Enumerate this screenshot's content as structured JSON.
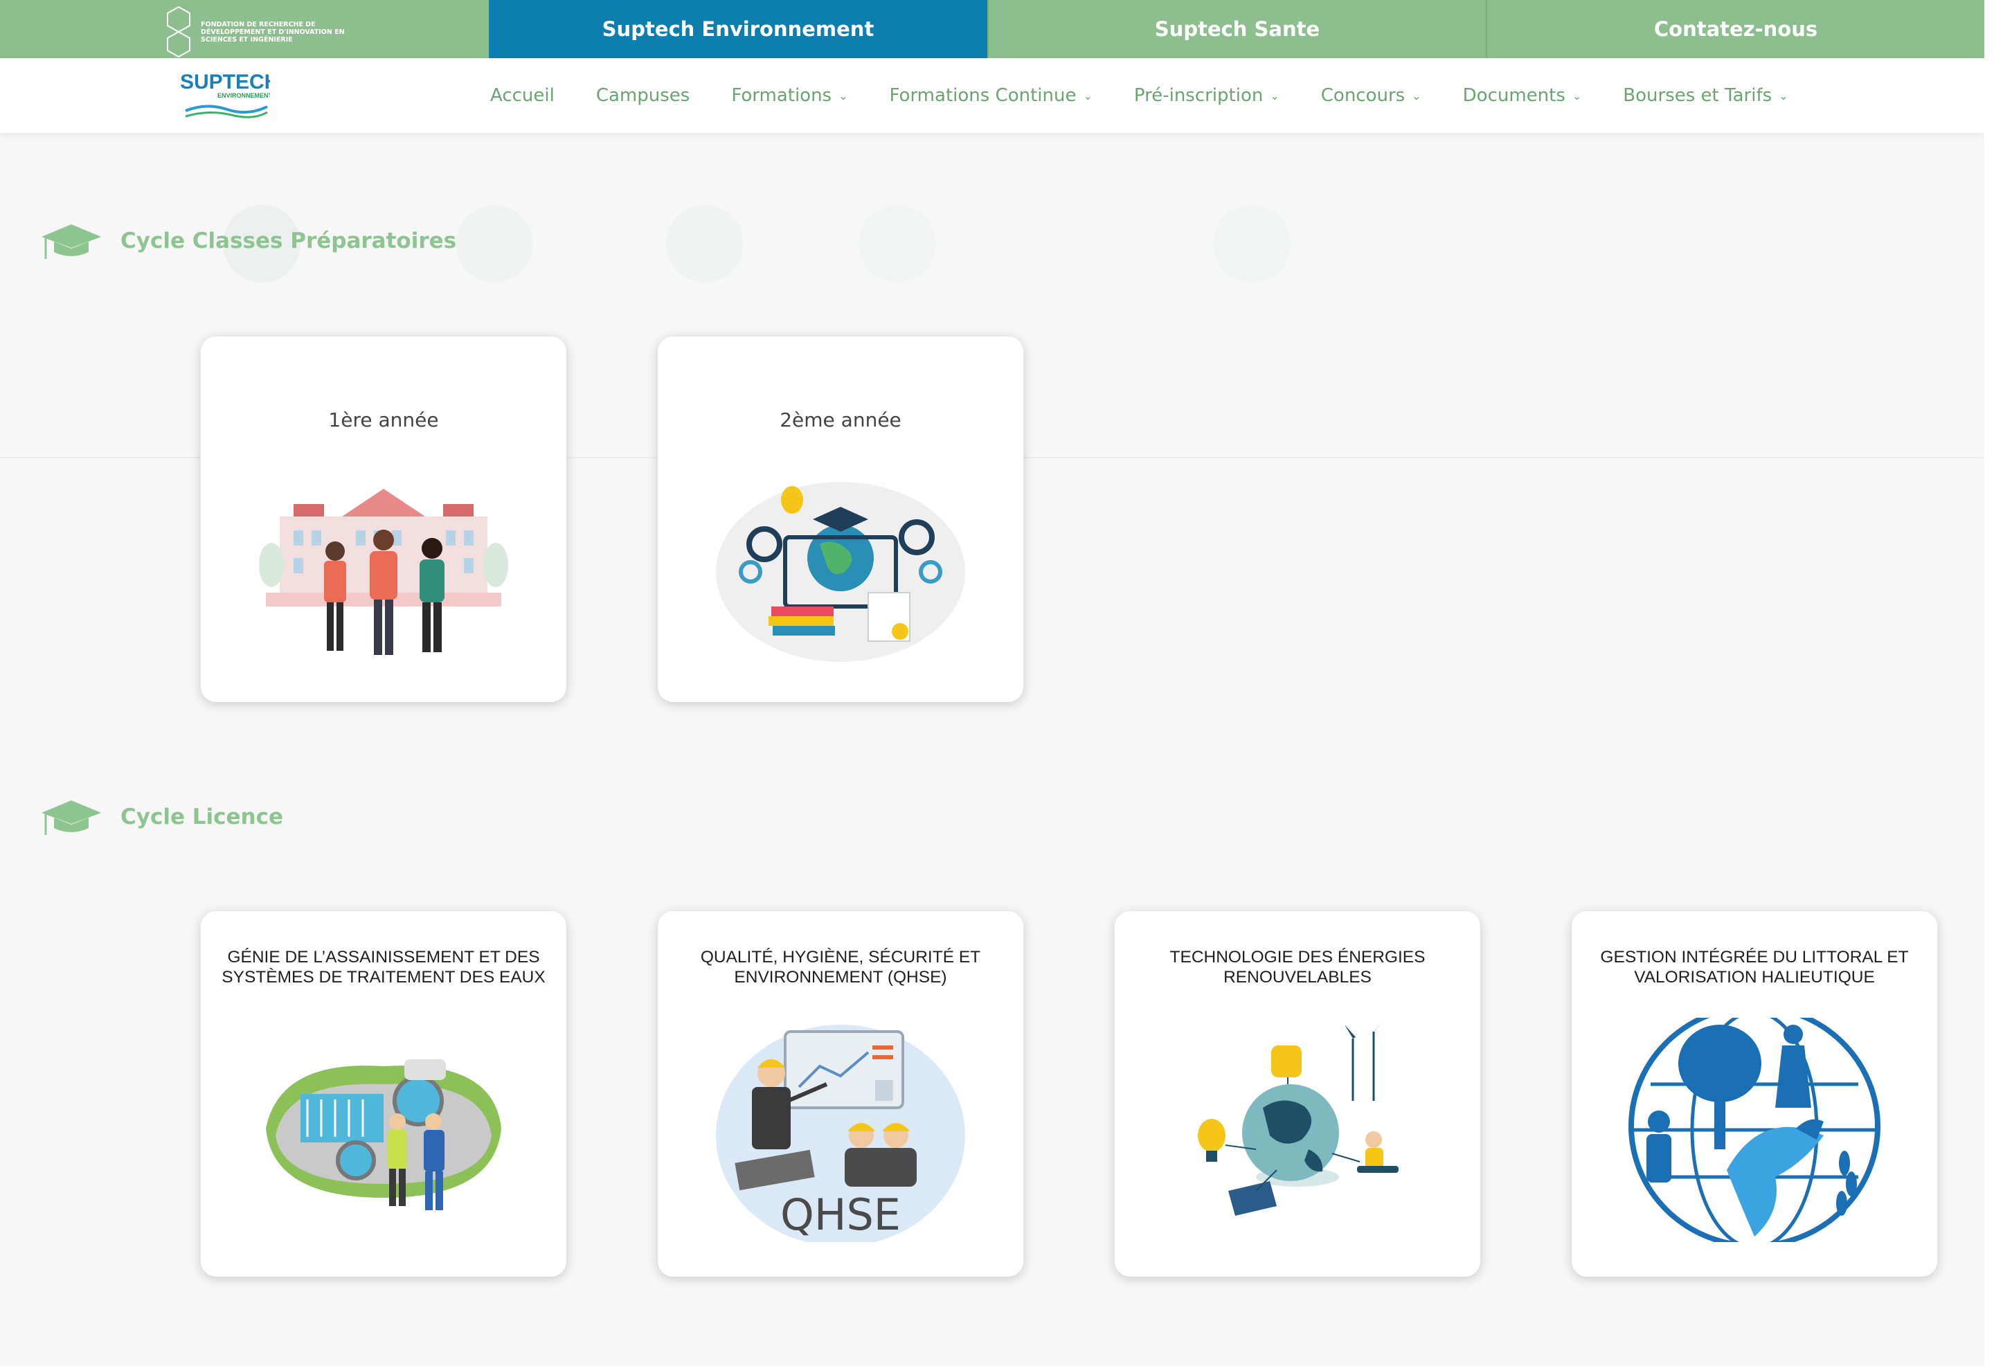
{
  "topbar": {
    "fondation_text": "Fondation de recherche de développement et d'innovation en sciences et ingénierie",
    "tabs": [
      {
        "label": "Suptech Environnement",
        "active": true
      },
      {
        "label": "Suptech Sante",
        "active": false
      },
      {
        "label": "Contatez-nous",
        "active": false
      }
    ]
  },
  "brand": {
    "name": "SUPTECH",
    "sub": "ENVIRONNEMENT"
  },
  "nav": {
    "items": [
      {
        "label": "Accueil",
        "dropdown": false
      },
      {
        "label": "Campuses",
        "dropdown": false
      },
      {
        "label": "Formations",
        "dropdown": true
      },
      {
        "label": "Formations Continue",
        "dropdown": true
      },
      {
        "label": "Pré-inscription",
        "dropdown": true
      },
      {
        "label": "Concours",
        "dropdown": true
      },
      {
        "label": "Documents",
        "dropdown": true
      },
      {
        "label": "Bourses et Tarifs",
        "dropdown": true
      }
    ]
  },
  "sections": {
    "prep": {
      "title": "Cycle Classes Préparatoires",
      "cards": [
        {
          "label": "1ère année",
          "art": "students-campus-illustration"
        },
        {
          "label": "2ème année",
          "art": "education-gears-globe-illustration"
        }
      ]
    },
    "licence": {
      "title": "Cycle Licence",
      "cards": [
        {
          "label": "Génie de l’Assainissement et des Systèmes de Traitement des Eaux",
          "art": "water-treatment-plant-illustration"
        },
        {
          "label": "Qualité, Hygiène, Sécurité et Environnement (QHSE)",
          "art": "qhse-training-illustration",
          "art_caption": "QHSE"
        },
        {
          "label": "Technologie des Énergies Renouvelables",
          "art": "renewable-energy-globe-illustration"
        },
        {
          "label": "Gestion Intégrée du Littoral et Valorisation Halieutique",
          "art": "coastal-ecology-globe-icon"
        }
      ]
    }
  },
  "colors": {
    "topbar_green": "#8dbf8e",
    "active_tab_blue": "#0c7fae",
    "nav_green": "#6aa571",
    "heading_green": "#8cc58f"
  }
}
